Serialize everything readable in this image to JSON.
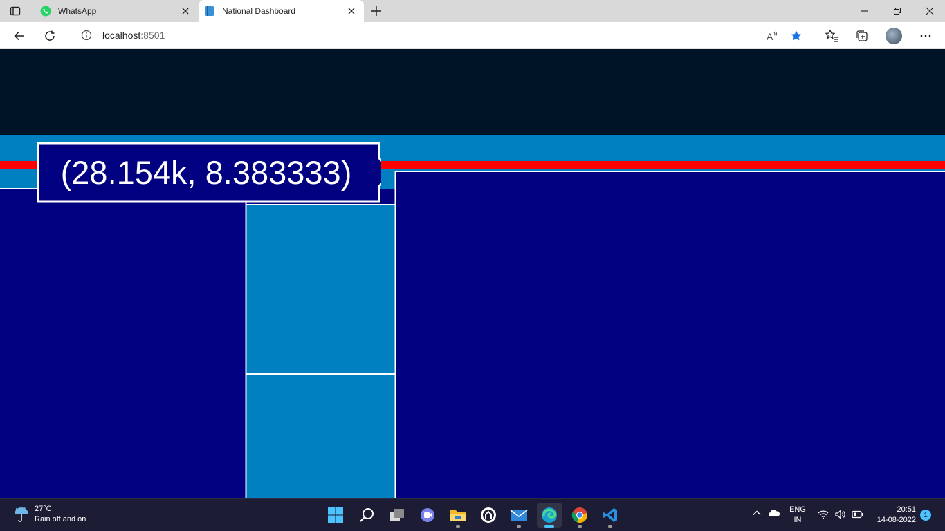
{
  "browser": {
    "tabs": [
      {
        "title": "WhatsApp",
        "active": false,
        "icon": "whatsapp-icon"
      },
      {
        "title": "National Dashboard",
        "active": true,
        "icon": "book-icon"
      }
    ],
    "address": {
      "host": "localhost",
      "port": ":8501"
    }
  },
  "dashboard": {
    "tooltip_text": "(28.154k, 8.383333)",
    "colors": {
      "header": "#001428",
      "primary": "#000080",
      "secondary": "#0080C0",
      "highlight": "#FF0000",
      "border": "#FFFFFF"
    },
    "treemap_tiles": [
      {
        "name": "large-left",
        "color": "#000080"
      },
      {
        "name": "top-strip",
        "color": "#0080C0"
      },
      {
        "name": "middle-upper",
        "color": "#0080C0"
      },
      {
        "name": "middle-lower",
        "color": "#0080C0"
      },
      {
        "name": "large-right",
        "color": "#000080"
      }
    ]
  },
  "taskbar": {
    "weather": {
      "temp": "27°C",
      "condition": "Rain off and on"
    },
    "language": {
      "line1": "ENG",
      "line2": "IN"
    },
    "clock": {
      "time": "20:51",
      "date": "14-08-2022"
    },
    "notifications": "1",
    "apps": [
      "windows-start-icon",
      "search-icon",
      "task-view-icon",
      "teams-chat-icon",
      "file-explorer-icon",
      "github-icon",
      "mail-icon",
      "edge-icon",
      "chrome-icon",
      "vscode-icon"
    ]
  }
}
